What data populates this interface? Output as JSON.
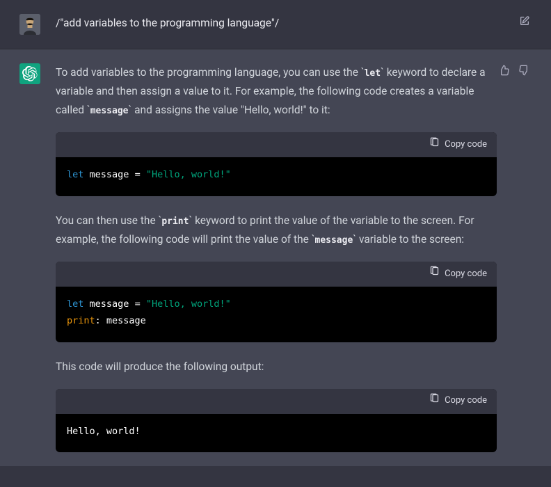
{
  "user": {
    "prompt": "/\"add variables to the programming language\"/"
  },
  "copy_label": "Copy code",
  "assistant": {
    "p1_a": "To add variables to the programming language, you can use the ",
    "kw_let": "let",
    "p1_b": " keyword to declare a variable and then assign a value to it. For example, the following code creates a variable called ",
    "kw_message": "message",
    "p1_c": " and assigns the value \"Hello, world!\" to it:",
    "p2_a": "You can then use the ",
    "kw_print": "print",
    "p2_b": " keyword to print the value of the variable to the screen. For example, the following code will print the value of the ",
    "p2_c": " variable to the screen:",
    "p3": "This code will produce the following output:",
    "code1": {
      "kw": "let",
      "id": "message",
      "eq": " = ",
      "str": "\"Hello, world!\""
    },
    "code2": {
      "kw": "let",
      "id": "message",
      "eq": " = ",
      "str": "\"Hello, world!\"",
      "line2_call": "print",
      "line2_sep": ": ",
      "line2_arg": "message"
    },
    "code3": {
      "out": "Hello, world!"
    }
  }
}
